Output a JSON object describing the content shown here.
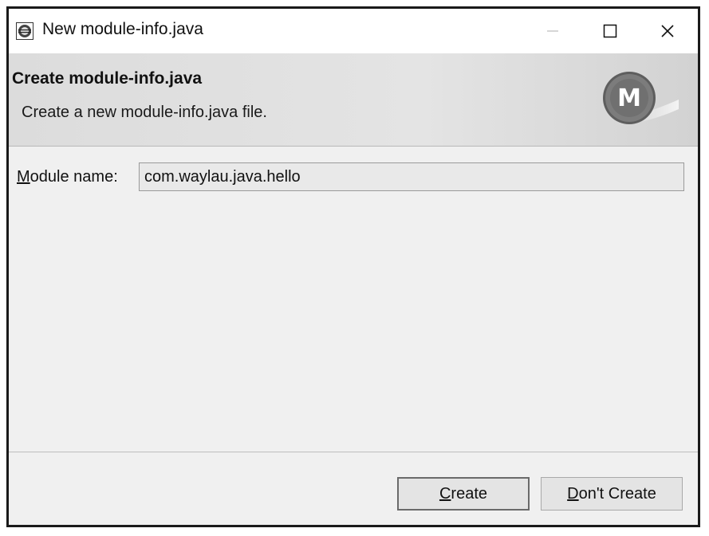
{
  "window": {
    "title": "New module-info.java",
    "minimize_glyph": "—",
    "maximize_glyph": "☐",
    "close_glyph": "✕"
  },
  "header": {
    "title": "Create module-info.java",
    "description": "Create a new module-info.java file.",
    "logo_letter": "M"
  },
  "form": {
    "module_name_label_mnemonic": "M",
    "module_name_label_rest": "odule name:",
    "module_name_value": "com.waylau.java.hello"
  },
  "buttons": {
    "create_mnemonic": "C",
    "create_rest": "reate",
    "dont_create_mnemonic": "D",
    "dont_create_rest": "on't Create"
  },
  "colors": {
    "window_border": "#1a1a1a",
    "dialog_bg": "#f0f0f0",
    "header_bg": "#e0e0e0",
    "logo_fill": "#7a7a7a"
  }
}
